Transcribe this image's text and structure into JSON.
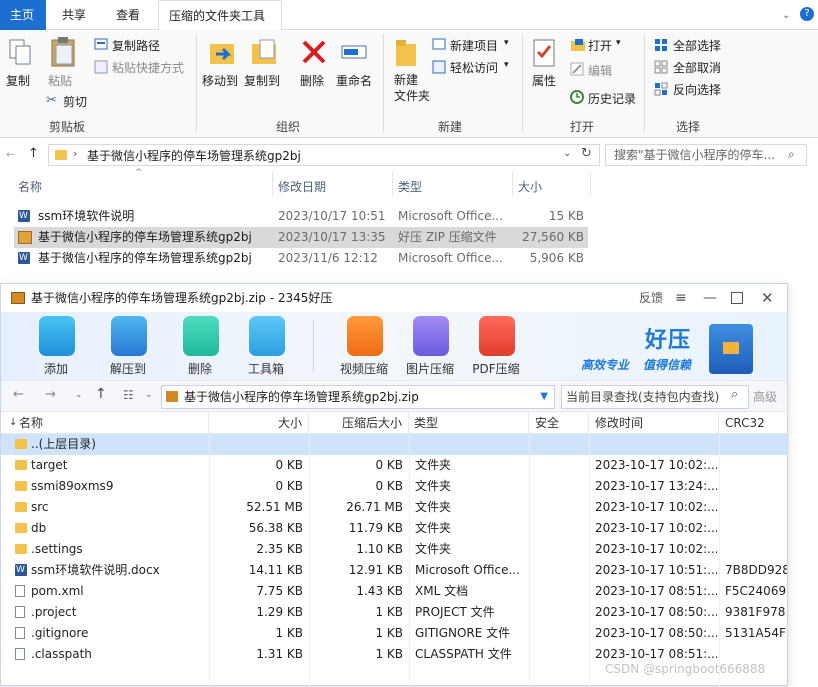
{
  "explorer": {
    "tabs": {
      "home": "主页",
      "share": "共享",
      "view": "查看",
      "tools": "压缩的文件夹工具"
    },
    "ribbon": {
      "copy": "复制",
      "paste": "粘贴",
      "copy_path": "复制路径",
      "paste_shortcut": "粘贴快捷方式",
      "cut": "剪切",
      "move_to": "移动到",
      "copy_to": "复制到",
      "delete": "删除",
      "rename": "重命名",
      "new_folder": "新建\n文件夹",
      "new_item": "新建项目",
      "easy_access": "轻松访问",
      "properties": "属性",
      "open": "打开",
      "edit": "编辑",
      "history": "历史记录",
      "select_all": "全部选择",
      "select_none": "全部取消",
      "invert": "反向选择",
      "groups": {
        "clipboard": "剪贴板",
        "organize": "组织",
        "new": "新建",
        "open": "打开",
        "select": "选择"
      }
    },
    "address": "基于微信小程序的停车场管理系统gp2bj",
    "search_placeholder": "搜索\"基于微信小程序的停车...",
    "columns": {
      "name": "名称",
      "date": "修改日期",
      "type": "类型",
      "size": "大小"
    },
    "files": [
      {
        "name": "ssm环境软件说明",
        "date": "2023/10/17 10:51",
        "type": "Microsoft Office...",
        "size": "15 KB"
      },
      {
        "name": "基于微信小程序的停车场管理系统gp2bj",
        "date": "2023/10/17 13:35",
        "type": "好压 ZIP 压缩文件",
        "size": "27,560 KB"
      },
      {
        "name": "基于微信小程序的停车场管理系统gp2bj",
        "date": "2023/11/6 12:12",
        "type": "Microsoft Office...",
        "size": "5,906 KB"
      }
    ]
  },
  "zip": {
    "title": "基于微信小程序的停车场管理系统gp2bj.zip - 2345好压",
    "feedback": "反馈",
    "toolbar": {
      "add": "添加",
      "extract": "解压到",
      "delete": "删除",
      "tools": "工具箱",
      "video": "视频压缩",
      "image": "图片压缩",
      "pdf": "PDF压缩"
    },
    "brand": {
      "name": "好压",
      "slogan1": "高效专业",
      "slogan2": "值得信赖"
    },
    "path": "基于微信小程序的停车场管理系统gp2bj.zip",
    "search_placeholder": "当前目录查找(支持包内查找)",
    "advanced": "高级",
    "columns": {
      "name": "名称",
      "size": "大小",
      "packed": "压缩后大小",
      "type": "类型",
      "security": "安全",
      "modified": "修改时间",
      "crc": "CRC32"
    },
    "rows": [
      {
        "name": "..(上层目录)",
        "size": "",
        "packed": "",
        "type": "",
        "modified": "",
        "crc": "",
        "icon": "folder"
      },
      {
        "name": "target",
        "size": "0 KB",
        "packed": "0 KB",
        "type": "文件夹",
        "modified": "2023-10-17 10:02:...",
        "crc": "",
        "icon": "folder"
      },
      {
        "name": "ssmi89oxms9",
        "size": "0 KB",
        "packed": "0 KB",
        "type": "文件夹",
        "modified": "2023-10-17 13:24:...",
        "crc": "",
        "icon": "folder"
      },
      {
        "name": "src",
        "size": "52.51 MB",
        "packed": "26.71 MB",
        "type": "文件夹",
        "modified": "2023-10-17 10:02:...",
        "crc": "",
        "icon": "folder"
      },
      {
        "name": "db",
        "size": "56.38 KB",
        "packed": "11.79 KB",
        "type": "文件夹",
        "modified": "2023-10-17 10:02:...",
        "crc": "",
        "icon": "folder"
      },
      {
        "name": ".settings",
        "size": "2.35 KB",
        "packed": "1.10 KB",
        "type": "文件夹",
        "modified": "2023-10-17 10:02:...",
        "crc": "",
        "icon": "folder"
      },
      {
        "name": "ssm环境软件说明.docx",
        "size": "14.11 KB",
        "packed": "12.91 KB",
        "type": "Microsoft Office...",
        "modified": "2023-10-17 10:51:...",
        "crc": "7B8DD928",
        "icon": "word"
      },
      {
        "name": "pom.xml",
        "size": "7.75 KB",
        "packed": "1.43 KB",
        "type": "XML 文档",
        "modified": "2023-10-17 08:51:...",
        "crc": "F5C24069",
        "icon": "doc"
      },
      {
        "name": ".project",
        "size": "1.29 KB",
        "packed": "1 KB",
        "type": "PROJECT 文件",
        "modified": "2023-10-17 08:50:...",
        "crc": "9381F978",
        "icon": "doc"
      },
      {
        "name": ".gitignore",
        "size": "1 KB",
        "packed": "1 KB",
        "type": "GITIGNORE 文件",
        "modified": "2023-10-17 08:50:...",
        "crc": "5131A54F",
        "icon": "doc"
      },
      {
        "name": ".classpath",
        "size": "1.31 KB",
        "packed": "1 KB",
        "type": "CLASSPATH 文件",
        "modified": "2023-10-17 08:51:...",
        "crc": "",
        "icon": "doc"
      }
    ],
    "watermark": "CSDN @springboot666888"
  }
}
